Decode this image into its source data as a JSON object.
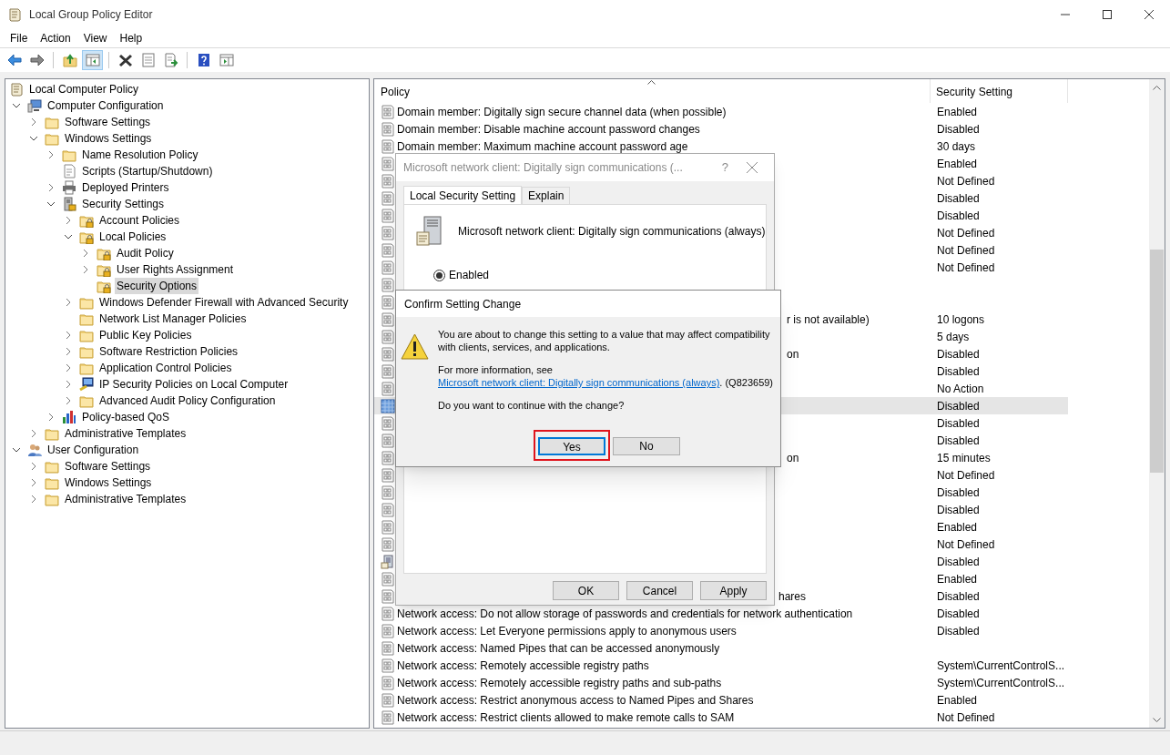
{
  "window": {
    "title": "Local Group Policy Editor"
  },
  "menu": [
    "File",
    "Action",
    "View",
    "Help"
  ],
  "toolbar": [
    {
      "kind": "back",
      "pressed": false
    },
    {
      "kind": "forward",
      "pressed": false
    },
    {
      "kind": "separator"
    },
    {
      "kind": "up",
      "pressed": false
    },
    {
      "kind": "console-tree",
      "pressed": true
    },
    {
      "kind": "separator"
    },
    {
      "kind": "delete",
      "pressed": false
    },
    {
      "kind": "properties",
      "pressed": false
    },
    {
      "kind": "export",
      "pressed": false
    },
    {
      "kind": "separator"
    },
    {
      "kind": "help",
      "pressed": false
    },
    {
      "kind": "action-pane",
      "pressed": false
    }
  ],
  "tree": [
    {
      "label": "Local Computer Policy",
      "kind": "root",
      "selected": false,
      "children": [
        {
          "label": "Computer Configuration",
          "kind": "computer",
          "expanded": true,
          "selected": false,
          "children": [
            {
              "label": "Software Settings",
              "kind": "folder",
              "expanded": false,
              "selected": false
            },
            {
              "label": "Windows Settings",
              "kind": "folder",
              "expanded": true,
              "selected": false,
              "children": [
                {
                  "label": "Name Resolution Policy",
                  "kind": "folder",
                  "expanded": false,
                  "selected": false
                },
                {
                  "label": "Scripts (Startup/Shutdown)",
                  "kind": "scripts",
                  "selected": false
                },
                {
                  "label": "Deployed Printers",
                  "kind": "printer",
                  "expanded": false,
                  "selected": false
                },
                {
                  "label": "Security Settings",
                  "kind": "security",
                  "expanded": true,
                  "selected": false,
                  "children": [
                    {
                      "label": "Account Policies",
                      "kind": "lock-folder",
                      "expanded": false,
                      "selected": false
                    },
                    {
                      "label": "Local Policies",
                      "kind": "lock-folder",
                      "expanded": true,
                      "selected": false,
                      "children": [
                        {
                          "label": "Audit Policy",
                          "kind": "lock-folder",
                          "expanded": false,
                          "selected": false
                        },
                        {
                          "label": "User Rights Assignment",
                          "kind": "lock-folder",
                          "expanded": false,
                          "selected": false
                        },
                        {
                          "label": "Security Options",
                          "kind": "lock-folder",
                          "selected": true
                        }
                      ]
                    },
                    {
                      "label": "Windows Defender Firewall with Advanced Security",
                      "kind": "folder",
                      "expanded": false,
                      "selected": false
                    },
                    {
                      "label": "Network List Manager Policies",
                      "kind": "folder",
                      "selected": false
                    },
                    {
                      "label": "Public Key Policies",
                      "kind": "folder",
                      "expanded": false,
                      "selected": false
                    },
                    {
                      "label": "Software Restriction Policies",
                      "kind": "folder",
                      "expanded": false,
                      "selected": false
                    },
                    {
                      "label": "Application Control Policies",
                      "kind": "folder",
                      "expanded": false,
                      "selected": false
                    },
                    {
                      "label": "IP Security Policies on Local Computer",
                      "kind": "ipsec",
                      "expanded": false,
                      "selected": false
                    },
                    {
                      "label": "Advanced Audit Policy Configuration",
                      "kind": "folder",
                      "expanded": false,
                      "selected": false
                    }
                  ]
                },
                {
                  "label": "Policy-based QoS",
                  "kind": "qos",
                  "expanded": false,
                  "selected": false
                }
              ]
            },
            {
              "label": "Administrative Templates",
              "kind": "folder",
              "expanded": false,
              "selected": false
            }
          ]
        },
        {
          "label": "User Configuration",
          "kind": "user",
          "expanded": true,
          "selected": false,
          "children": [
            {
              "label": "Software Settings",
              "kind": "folder",
              "expanded": false,
              "selected": false
            },
            {
              "label": "Windows Settings",
              "kind": "folder",
              "expanded": false,
              "selected": false
            },
            {
              "label": "Administrative Templates",
              "kind": "folder",
              "expanded": false,
              "selected": false
            }
          ]
        }
      ]
    }
  ],
  "list": {
    "columns": [
      "Policy",
      "Security Setting"
    ],
    "rows": [
      {
        "kind": "policy",
        "selected": false,
        "policy": "Domain member: Digitally sign secure channel data (when possible)",
        "setting": "Enabled"
      },
      {
        "kind": "policy",
        "selected": false,
        "policy": "Domain member: Disable machine account password changes",
        "setting": "Disabled"
      },
      {
        "kind": "policy",
        "selected": false,
        "policy": "Domain member: Maximum machine account password age",
        "setting": "30 days"
      },
      {
        "kind": "policy",
        "selected": false,
        "setting": "Enabled"
      },
      {
        "kind": "policy",
        "selected": false,
        "setting": "Not Defined"
      },
      {
        "kind": "policy",
        "selected": false,
        "setting": "Disabled"
      },
      {
        "kind": "policy",
        "selected": false,
        "setting": "Disabled"
      },
      {
        "kind": "policy",
        "selected": false,
        "setting": "Not Defined"
      },
      {
        "kind": "policy",
        "selected": false,
        "setting": "Not Defined"
      },
      {
        "kind": "policy",
        "selected": false,
        "setting": "Not Defined"
      },
      {
        "kind": "policy",
        "selected": false
      },
      {
        "kind": "policy",
        "selected": false
      },
      {
        "kind": "policy",
        "selected": false,
        "fragment": "r is not available)",
        "setting": "10 logons"
      },
      {
        "kind": "policy",
        "selected": false,
        "setting": "5 days"
      },
      {
        "kind": "policy",
        "selected": false,
        "fragment": "on",
        "setting": "Disabled"
      },
      {
        "kind": "policy",
        "selected": false,
        "setting": "Disabled"
      },
      {
        "kind": "policy",
        "selected": false,
        "setting": "No Action"
      },
      {
        "kind": "policy",
        "selected": true,
        "setting": "Disabled"
      },
      {
        "kind": "policy",
        "selected": false,
        "setting": "Disabled"
      },
      {
        "kind": "policy",
        "selected": false,
        "setting": "Disabled"
      },
      {
        "kind": "policy",
        "selected": false,
        "fragment": "on",
        "setting": "15 minutes"
      },
      {
        "kind": "policy",
        "selected": false,
        "setting": "Not Defined"
      },
      {
        "kind": "policy",
        "selected": false,
        "setting": "Disabled"
      },
      {
        "kind": "policy",
        "selected": false,
        "setting": "Disabled"
      },
      {
        "kind": "policy",
        "selected": false,
        "setting": "Enabled"
      },
      {
        "kind": "policy",
        "selected": false,
        "setting": "Not Defined"
      },
      {
        "kind": "server",
        "selected": false,
        "setting": "Disabled"
      },
      {
        "kind": "policy",
        "selected": false,
        "setting": "Enabled"
      },
      {
        "kind": "policy",
        "selected": false,
        "fragment": "hares",
        "setting": "Disabled"
      },
      {
        "kind": "policy",
        "selected": false,
        "policy": "Network access: Do not allow storage of passwords and credentials for network authentication",
        "setting": "Disabled"
      },
      {
        "kind": "policy",
        "selected": false,
        "policy": "Network access: Let Everyone permissions apply to anonymous users",
        "setting": "Disabled"
      },
      {
        "kind": "policy",
        "selected": false,
        "policy": "Network access: Named Pipes that can be accessed anonymously"
      },
      {
        "kind": "policy",
        "selected": false,
        "policy": "Network access: Remotely accessible registry paths",
        "setting": "System\\CurrentControlS..."
      },
      {
        "kind": "policy",
        "selected": false,
        "policy": "Network access: Remotely accessible registry paths and sub-paths",
        "setting": "System\\CurrentControlS..."
      },
      {
        "kind": "policy",
        "selected": false,
        "policy": "Network access: Restrict anonymous access to Named Pipes and Shares",
        "setting": "Enabled"
      },
      {
        "kind": "policy",
        "selected": false,
        "policy": "Network access: Restrict clients allowed to make remote calls to SAM",
        "setting": "Not Defined"
      }
    ]
  },
  "properties_dialog": {
    "title": "Microsoft network client: Digitally sign communications (...",
    "help": "?",
    "tabs": [
      {
        "label": "Local Security Setting",
        "selected": true
      },
      {
        "label": "Explain",
        "selected": false
      }
    ],
    "policy_name": "Microsoft network client: Digitally sign communications (always)",
    "options": [
      {
        "label": "Enabled",
        "checked": true
      }
    ],
    "buttons": [
      "OK",
      "Cancel",
      "Apply"
    ]
  },
  "confirm_dialog": {
    "title": "Confirm Setting Change",
    "message": "You are about to change this setting to a value that may affect compatibility with clients, services, and applications.",
    "info_prefix": "For more information, see",
    "info_link": "Microsoft network client: Digitally sign communications (always)",
    "info_suffix": ". (Q823659)",
    "question": "Do you want to continue with the change?",
    "buttons": [
      {
        "label": "Yes",
        "focused": true,
        "highlighted": true
      },
      {
        "label": "No",
        "focused": false,
        "highlighted": false
      }
    ]
  }
}
